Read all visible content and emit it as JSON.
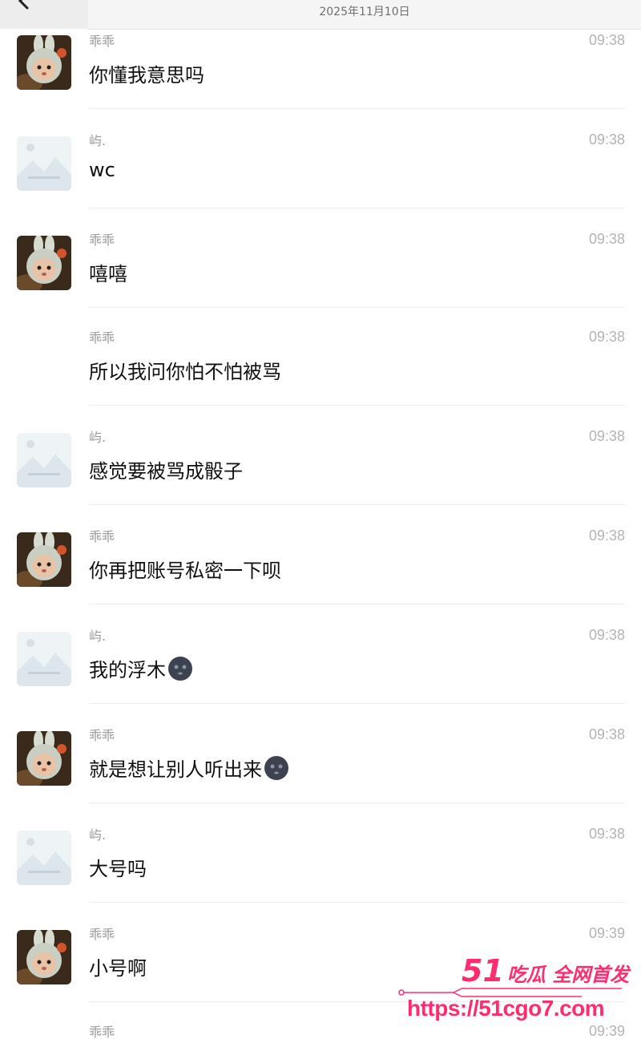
{
  "header": {
    "date": "2025年11月10日",
    "back_icon": "chevron-left-icon"
  },
  "messages": [
    {
      "sender": "乖乖",
      "time": "09:38",
      "text": "你懂我意思吗",
      "avatar": "bunny-avatar",
      "emoji": ""
    },
    {
      "sender": "屿.",
      "time": "09:38",
      "text": "wc",
      "avatar": "landscape-placeholder-avatar",
      "emoji": ""
    },
    {
      "sender": "乖乖",
      "time": "09:38",
      "text": "嘻嘻",
      "avatar": "bunny-avatar",
      "emoji": ""
    },
    {
      "sender": "乖乖",
      "time": "09:38",
      "text": "所以我问你怕不怕被骂",
      "avatar": "",
      "emoji": ""
    },
    {
      "sender": "屿.",
      "time": "09:38",
      "text": "感觉要被骂成骰子",
      "avatar": "landscape-placeholder-avatar",
      "emoji": ""
    },
    {
      "sender": "乖乖",
      "time": "09:38",
      "text": "你再把账号私密一下呗",
      "avatar": "bunny-avatar",
      "emoji": ""
    },
    {
      "sender": "屿.",
      "time": "09:38",
      "text": "我的浮木",
      "avatar": "landscape-placeholder-avatar",
      "emoji": "dark-face-emoji"
    },
    {
      "sender": "乖乖",
      "time": "09:38",
      "text": "就是想让别人听出来",
      "avatar": "bunny-avatar",
      "emoji": "dark-face-emoji"
    },
    {
      "sender": "屿.",
      "time": "09:38",
      "text": "大号吗",
      "avatar": "landscape-placeholder-avatar",
      "emoji": ""
    },
    {
      "sender": "乖乖",
      "time": "09:39",
      "text": "小号啊",
      "avatar": "bunny-avatar",
      "emoji": ""
    },
    {
      "sender": "乖乖",
      "time": "09:39",
      "text": "",
      "avatar": "",
      "emoji": ""
    }
  ],
  "watermark": {
    "number": "51",
    "slogan": "吃瓜 全网首发",
    "url": "https://51cgo7.com"
  },
  "colors": {
    "watermark": "#ff2d6e",
    "time": "#b4b4b4",
    "sender": "#9a9a9a"
  }
}
